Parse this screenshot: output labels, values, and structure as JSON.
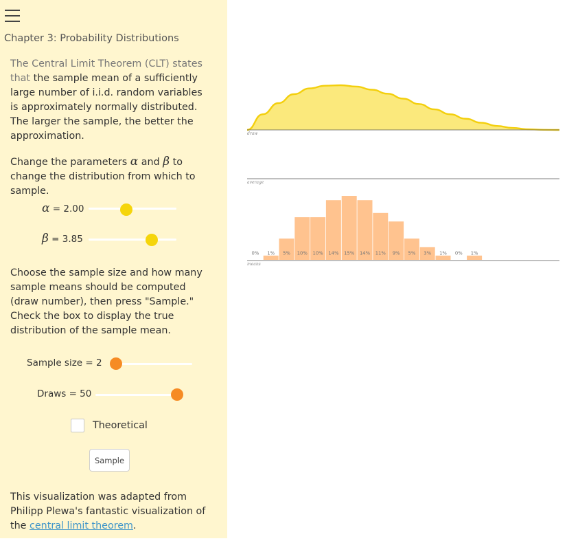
{
  "sidebar": {
    "menu_icon": "hamburger-menu-icon",
    "chapter": "Chapter 3: Probability Distributions",
    "intro_lead": "The Central Limit Theorem (CLT) states that",
    "intro_rest": "the sample mean of a sufficiently large number of i.i.d. random variables is approximately normally distributed. The larger the sample, the better the approximation.",
    "params_pre": "Change the parameters",
    "params_and": "and",
    "params_post": "to change the distribution from which to sample.",
    "alpha_symbol": "α",
    "beta_symbol": "β",
    "alpha_label": "= 2.00",
    "beta_label": "= 3.85",
    "alpha_value": 2.0,
    "beta_value": 3.85,
    "alpha_slider_fraction": 0.42,
    "beta_slider_fraction": 0.75,
    "sample_instructions": "Choose the sample size and how many sample means should be computed (draw number), then press \"Sample.\" Check the box to display the true distribution of the sample mean.",
    "sample_size_label": "Sample size = 2",
    "sample_size_value": 2,
    "sample_size_slider_fraction": 0.0,
    "draws_label": "Draws = 50",
    "draws_value": 50,
    "draws_slider_fraction": 1.0,
    "theoretical_label": "Theoretical",
    "theoretical_checked": false,
    "sample_button": "Sample",
    "credit_pre": "This visualization was adapted from Philipp Plewa's fantastic visualization of the",
    "credit_link": "central limit theorem",
    "credit_post": "."
  },
  "viz": {
    "draw_axis_label": "draw",
    "average_axis_label": "average",
    "means_axis_label": "means"
  },
  "colors": {
    "sidebar_bg": "#fff6cf",
    "density_fill": "#fbe97c",
    "density_stroke": "#f3cf0d",
    "bar_fill": "#ffc38f",
    "accent_yellow": "#f5d50c",
    "accent_orange": "#f68b24",
    "link": "#3f95c9"
  },
  "chart_data": [
    {
      "type": "area",
      "x": [
        0,
        0.05,
        0.1,
        0.15,
        0.2,
        0.25,
        0.3,
        0.35,
        0.4,
        0.45,
        0.5,
        0.55,
        0.6,
        0.65,
        0.7,
        0.75,
        0.8,
        0.85,
        0.9,
        0.95,
        1.0
      ],
      "values": [
        0.0,
        0.35,
        0.6,
        0.8,
        0.93,
        0.99,
        1.0,
        0.97,
        0.9,
        0.81,
        0.7,
        0.58,
        0.46,
        0.35,
        0.25,
        0.16,
        0.09,
        0.045,
        0.015,
        0.003,
        0.0
      ],
      "xlim": [
        0,
        1
      ]
    },
    {
      "type": "bar",
      "categories": [
        "b1",
        "b2",
        "b3",
        "b4",
        "b5",
        "b6",
        "b7",
        "b8",
        "b9",
        "b10",
        "b11",
        "b12",
        "b13",
        "b14",
        "b15"
      ],
      "values": [
        0,
        1,
        5,
        10,
        10,
        14,
        15,
        14,
        11,
        9,
        5,
        3,
        1,
        0,
        1
      ],
      "labels": [
        "0%",
        "1%",
        "5%",
        "10%",
        "10%",
        "14%",
        "15%",
        "14%",
        "11%",
        "9%",
        "5%",
        "3%",
        "1%",
        "0%",
        "1%"
      ]
    }
  ]
}
